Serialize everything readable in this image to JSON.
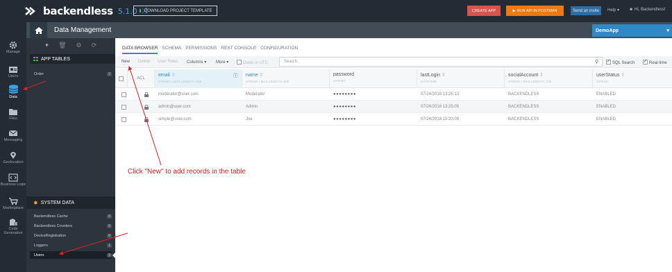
{
  "topbar": {
    "brand": "backendless",
    "version": "5.1.0",
    "download_label": "DOWNLOAD PROJECT TEMPLATE",
    "create_app": "CREATE APP",
    "postman": "RUN API IN POSTMAN",
    "send_invite": "Send an invite",
    "help": "Help",
    "user_greeting": "Hi, Backendless!"
  },
  "iconnav": {
    "items": [
      {
        "label": "Manage",
        "icon": "gear-icon"
      },
      {
        "label": "Users",
        "icon": "users-icon"
      },
      {
        "label": "Data",
        "icon": "database-icon"
      },
      {
        "label": "Files",
        "icon": "folder-icon"
      },
      {
        "label": "Messaging",
        "icon": "envelope-icon"
      },
      {
        "label": "Geolocation",
        "icon": "map-pin-icon"
      },
      {
        "label": "Business Logic",
        "icon": "code-icon"
      },
      {
        "label": "Marketplace",
        "icon": "cart-icon"
      },
      {
        "label": "Code Generation",
        "icon": "code-generation-icon"
      }
    ]
  },
  "subhead": {
    "title": "Data Management",
    "app": "DemoApp"
  },
  "sidebar": {
    "app_tables_title": "APP TABLES",
    "app_tables": [
      {
        "name": "Order",
        "count": "2"
      }
    ],
    "system_data_title": "SYSTEM DATA",
    "system_tables": [
      {
        "name": "Backendless Cache",
        "count": "0"
      },
      {
        "name": "Backendless Counters",
        "count": "0"
      },
      {
        "name": "DeviceRegistration",
        "count": "0"
      },
      {
        "name": "Loggers",
        "count": "1"
      },
      {
        "name": "Users",
        "count": "3"
      }
    ]
  },
  "tabs": [
    "DATA BROWSER",
    "SCHEMA",
    "PERMISSIONS",
    "REST CONSOLE",
    "CONFIGURATION"
  ],
  "toolbar": {
    "new": "New",
    "delete": "Delete",
    "user_roles": "User Roles",
    "columns": "Columns ▾",
    "more": "More ▾",
    "dates_utc": "Dates in UTC",
    "search_placeholder": "Search",
    "sql_search": "SQL Search",
    "realtime": "Real-time"
  },
  "table": {
    "acl_label": "ACL",
    "columns": [
      {
        "name": "email",
        "type": "STRING | MAX LENGTH: 500"
      },
      {
        "name": "name",
        "type": "STRING | MAX LENGTH: 500"
      },
      {
        "name": "password",
        "type": "STRING"
      },
      {
        "name": "lastLogin",
        "type": "DATETIME"
      },
      {
        "name": "socialAccount",
        "type": "STRING | MAX LENGTH: 100"
      },
      {
        "name": "userStatus",
        "type": "STRING"
      }
    ],
    "rows": [
      {
        "email": "moderator@user.com",
        "name": "Moderator",
        "password": "●●●●●●●●",
        "lastLogin": "07/24/2018 13:25:13",
        "socialAccount": "BACKENDLESS",
        "userStatus": "ENABLED"
      },
      {
        "email": "admin@user.com",
        "name": "Admin",
        "password": "●●●●●●●●",
        "lastLogin": "07/24/2018 13:25:05",
        "socialAccount": "BACKENDLESS",
        "userStatus": "ENABLED"
      },
      {
        "email": "simple@user.com",
        "name": "Joe",
        "password": "●●●●●●●●",
        "lastLogin": "07/24/2018 15:20:09",
        "socialAccount": "BACKENDLESS",
        "userStatus": "ENABLED"
      }
    ]
  },
  "annotation": "Click \"New\" to add records in the table",
  "colors": {
    "accent": "#2d89c8",
    "annotation": "#e02020",
    "create_app": "#d9534f",
    "postman": "#f0780f"
  }
}
